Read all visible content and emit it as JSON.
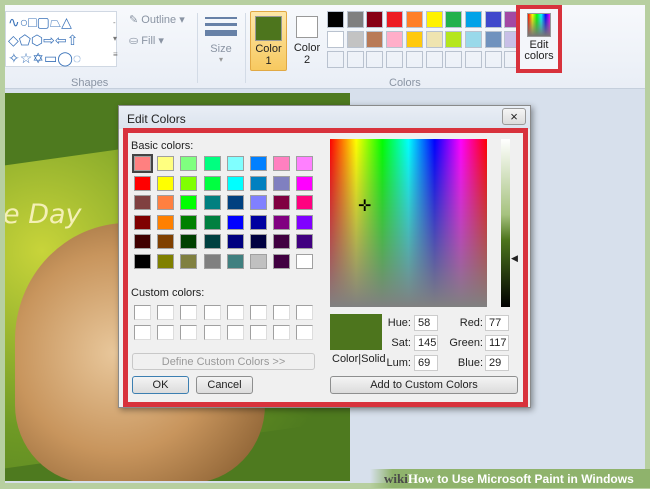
{
  "ribbon": {
    "shapes_label": "Shapes",
    "outline_label": "Outline",
    "fill_label": "Fill",
    "size_label": "Size",
    "color1_label": "Color",
    "color1_num": "1",
    "color2_label": "Color",
    "color2_num": "2",
    "colors_label": "Colors",
    "edit_colors_line1": "Edit",
    "edit_colors_line2": "colors",
    "color1": "#4d751d",
    "color2": "#ffffff",
    "palette_row1": [
      "#000000",
      "#7f7f7f",
      "#880015",
      "#ed1c24",
      "#ff7f27",
      "#fff200",
      "#22b14c",
      "#00a2e8",
      "#3f48cc",
      "#a349a4"
    ],
    "palette_row2": [
      "#ffffff",
      "#c3c3c3",
      "#b97a57",
      "#ffaec9",
      "#ffc90e",
      "#efe4b0",
      "#b5e61d",
      "#99d9ea",
      "#7092be",
      "#c8bfe7"
    ]
  },
  "photo": {
    "caption": "e Day"
  },
  "dialog": {
    "title": "Edit Colors",
    "close": "×",
    "basic_label": "Basic colors:",
    "custom_label": "Custom colors:",
    "basic_colors": [
      "#ff8080",
      "#ffff80",
      "#80ff80",
      "#00ff80",
      "#80ffff",
      "#0080ff",
      "#ff80c0",
      "#ff80ff",
      "#ff0000",
      "#ffff00",
      "#80ff00",
      "#00ff40",
      "#00ffff",
      "#0080c0",
      "#8080c0",
      "#ff00ff",
      "#804040",
      "#ff8040",
      "#00ff00",
      "#008080",
      "#004080",
      "#8080ff",
      "#800040",
      "#ff0080",
      "#800000",
      "#ff8000",
      "#008000",
      "#008040",
      "#0000ff",
      "#0000a0",
      "#800080",
      "#8000ff",
      "#400000",
      "#804000",
      "#004000",
      "#004040",
      "#000080",
      "#000040",
      "#400040",
      "#400080",
      "#000000",
      "#808000",
      "#808040",
      "#808080",
      "#408080",
      "#c0c0c0",
      "#400040",
      "#ffffff"
    ],
    "define_button": "Define Custom Colors >>",
    "ok": "OK",
    "cancel": "Cancel",
    "color_solid": "Color|Solid",
    "add_button": "Add to Custom Colors",
    "hue_label": "Hue:",
    "hue": "58",
    "sat_label": "Sat:",
    "sat": "145",
    "lum_label": "Lum:",
    "lum": "69",
    "red_label": "Red:",
    "red": "77",
    "green_label": "Green:",
    "green": "117",
    "blue_label": "Blue:",
    "blue": "29",
    "preview_color": "#4d751d"
  },
  "footer": {
    "wiki": "wiki",
    "how": "How",
    "title": "to Use Microsoft Paint in Windows"
  }
}
